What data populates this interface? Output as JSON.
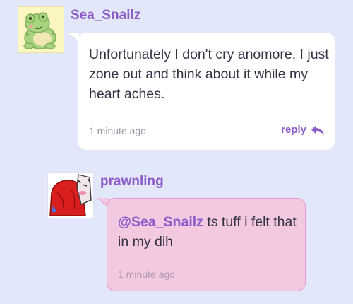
{
  "comments": [
    {
      "username": "Sea_Snailz",
      "body": "Unfortunately I don't cry anomore, I just zone out and think about it while my heart aches.",
      "timestamp": "1 minute ago",
      "reply_label": "reply",
      "avatar_icon": "frog-avatar-icon",
      "accent_color": "#8c5cc8",
      "bubble_color": "#ffffff"
    },
    {
      "username": "prawnling",
      "mention": "@Sea_Snailz",
      "body": " ts tuff i felt that in my dih",
      "timestamp": "1 minute ago",
      "avatar_icon": "red-character-avatar-icon",
      "bubble_color": "#f2c9e0"
    }
  ]
}
